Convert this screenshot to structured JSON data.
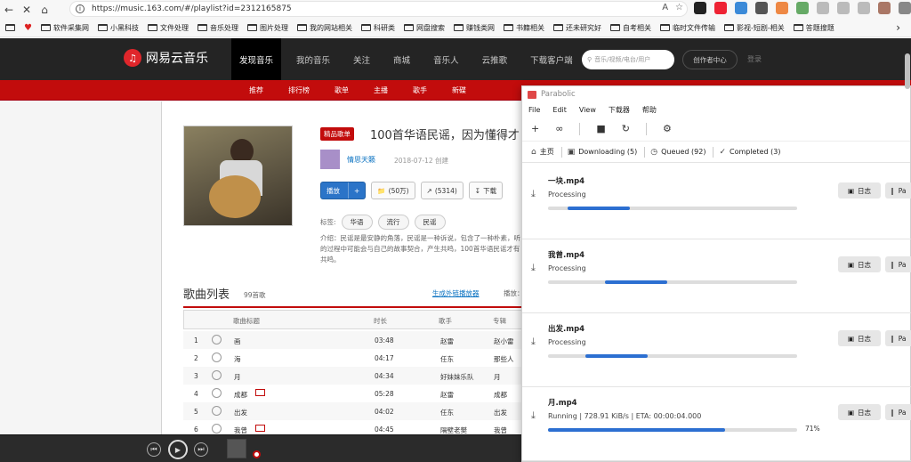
{
  "browser": {
    "url": "https://music.163.com/#/playlist?id=2312165875",
    "read_aloud": "A",
    "bookmarks": [
      "软件采集网",
      "小黑科技",
      "文件处理",
      "音乐处理",
      "图片处理",
      "我的网站相关",
      "科研类",
      "网盘搜索",
      "赚钱类网",
      "书籍相关",
      "还未研究好",
      "自考相关",
      "临时文件传输",
      "影视-短剧-相关",
      "答题搜题"
    ]
  },
  "netease": {
    "logo": "网易云音乐",
    "nav": [
      "发现音乐",
      "我的音乐",
      "关注",
      "商城",
      "音乐人",
      "云推歌",
      "下载客户端"
    ],
    "search_placeholder": "音乐/视频/电台/用户",
    "creator": "创作者中心",
    "login": "登录",
    "subnav": [
      "推荐",
      "排行榜",
      "歌单",
      "主播",
      "歌手",
      "新碟"
    ],
    "playlist": {
      "badge": "精品歌单",
      "title": "100首华语民谣，因为懂得才",
      "user": "情思天籁",
      "created": "2018-07-12 创建",
      "play": "播放",
      "plus": "+",
      "collect": "(50万)",
      "share": "(5314)",
      "download": "下载",
      "tags_label": "标签:",
      "tags": [
        "华语",
        "流行",
        "民谣"
      ],
      "intro": "介绍：民谣是最安静的角落，民谣是一种诉说，包含了一种朴素，听的过程中可能会与自己的故事契合，产生共鸣，100首华语民谣才有共鸣。"
    },
    "list": {
      "title": "歌曲列表",
      "count": "99首歌",
      "gen_link": "生成外链播放器",
      "play_count": "播放：",
      "columns": [
        "歌曲标题",
        "时长",
        "歌手",
        "专辑"
      ],
      "rows": [
        {
          "n": "1",
          "title": "画",
          "dur": "03:48",
          "artist": "赵雷",
          "album": "赵小雷",
          "mv": false
        },
        {
          "n": "2",
          "title": "海",
          "dur": "04:17",
          "artist": "任东",
          "album": "那些人",
          "mv": false
        },
        {
          "n": "3",
          "title": "月",
          "dur": "04:34",
          "artist": "好妹妹乐队",
          "album": "月",
          "mv": false
        },
        {
          "n": "4",
          "title": "成都",
          "dur": "05:28",
          "artist": "赵雷",
          "album": "成都",
          "mv": true
        },
        {
          "n": "5",
          "title": "出发",
          "dur": "04:02",
          "artist": "任东",
          "album": "出发",
          "mv": false
        },
        {
          "n": "6",
          "title": "我曾",
          "dur": "04:45",
          "artist": "隔壁老樊",
          "album": "我曾",
          "mv": true
        }
      ]
    }
  },
  "parabolic": {
    "title": "Parabolic",
    "menu": [
      "File",
      "Edit",
      "View",
      "下载器",
      "帮助"
    ],
    "tabs": {
      "home": "主页",
      "downloading": "Downloading (5)",
      "queued": "Queued (92)",
      "completed": "Completed (3)"
    },
    "downloads": [
      {
        "name": "一块.mp4",
        "status": "Processing",
        "start": 0.08,
        "progress": 0.33,
        "percent": "",
        "log": "日志",
        "pause": "Pa"
      },
      {
        "name": "我曾.mp4",
        "status": "Processing",
        "start": 0.23,
        "progress": 0.48,
        "percent": "",
        "log": "日志",
        "pause": "Pa"
      },
      {
        "name": "出发.mp4",
        "status": "Processing",
        "start": 0.15,
        "progress": 0.4,
        "percent": "",
        "log": "日志",
        "pause": "Pa"
      },
      {
        "name": "月.mp4",
        "status": "Running | 728.91 KiB/s | ETA: 00:00:04.000",
        "start": 0,
        "progress": 0.71,
        "percent": "71%",
        "log": "日志",
        "pause": "Pa"
      }
    ]
  },
  "colors": {
    "netease_red": "#c20c0c",
    "progress_blue": "#2c6fd1",
    "header_dark": "#242424"
  }
}
